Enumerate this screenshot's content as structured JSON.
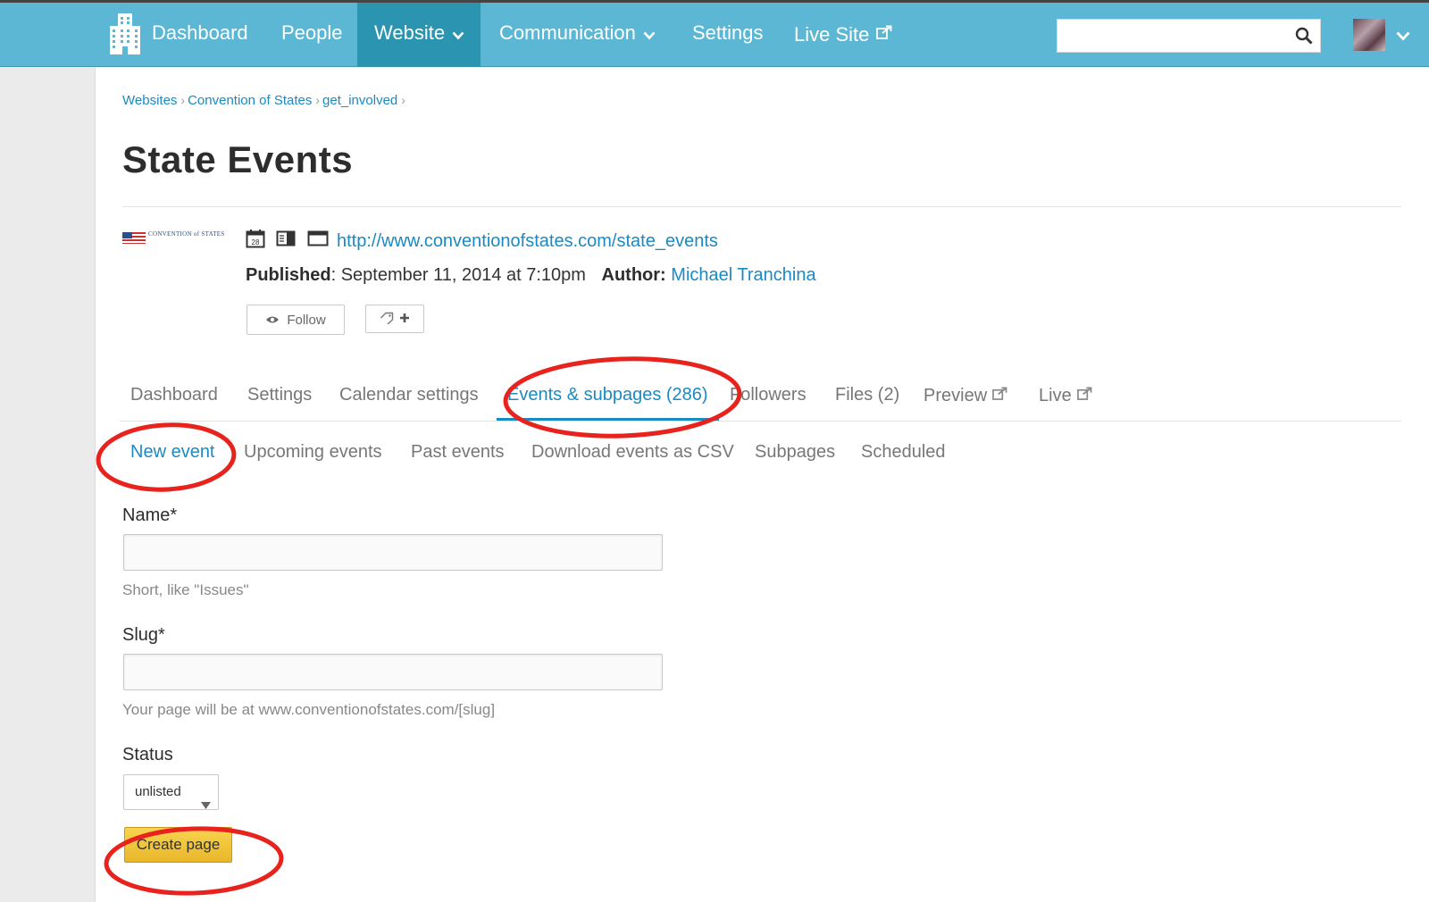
{
  "colors": {
    "topbar": "#5bb7d4",
    "nav_active": "#2b94b0",
    "link": "#1a8ac3",
    "annotation": "#e8221c",
    "create_button": "#f2c53d"
  },
  "topnav": {
    "items": [
      {
        "label": "Dashboard",
        "icon": "building-logo-icon"
      },
      {
        "label": "People"
      },
      {
        "label": "Website",
        "has_dropdown": true,
        "active": true
      },
      {
        "label": "Communication",
        "has_dropdown": true
      },
      {
        "label": "Settings"
      },
      {
        "label": "Live Site",
        "icon": "external-link-icon"
      }
    ],
    "search": {
      "placeholder": "",
      "icon": "search-icon"
    },
    "avatar": "user-avatar"
  },
  "breadcrumb": [
    "Websites",
    "Convention of States",
    "get_involved"
  ],
  "page": {
    "title": "State Events",
    "site_logo_text": "CONVENTION of STATES",
    "meta_icons": [
      "calendar-icon",
      "sidebar-layout-icon",
      "window-icon"
    ],
    "url": "http://www.conventionofstates.com/state_events",
    "published_label": "Published",
    "published_value": ": September 11, 2014 at 7:10pm",
    "author_label": "Author:",
    "author_name": "Michael Tranchina",
    "follow_label": "Follow",
    "tag_button_icons": [
      "tag-icon",
      "plus-icon"
    ]
  },
  "tabs": [
    {
      "label": "Dashboard"
    },
    {
      "label": "Settings"
    },
    {
      "label": "Calendar settings"
    },
    {
      "label": "Events & subpages (286)",
      "active": true
    },
    {
      "label": "Followers"
    },
    {
      "label": "Files (2)"
    },
    {
      "label": "Preview",
      "icon": "external-link-icon"
    },
    {
      "label": "Live",
      "icon": "external-link-icon"
    }
  ],
  "subtabs": [
    {
      "label": "New event",
      "active": true
    },
    {
      "label": "Upcoming events"
    },
    {
      "label": "Past events"
    },
    {
      "label": "Download events as CSV"
    },
    {
      "label": "Subpages"
    },
    {
      "label": "Scheduled"
    }
  ],
  "form": {
    "name_label": "Name*",
    "name_value": "",
    "name_hint": "Short, like \"Issues\"",
    "slug_label": "Slug*",
    "slug_value": "",
    "slug_hint": "Your page will be at www.conventionofstates.com/[slug]",
    "status_label": "Status",
    "status_value": "unlisted",
    "submit_label": "Create page"
  },
  "annotations": [
    "events-subpages-tab",
    "new-event-subtab",
    "create-page-button"
  ]
}
